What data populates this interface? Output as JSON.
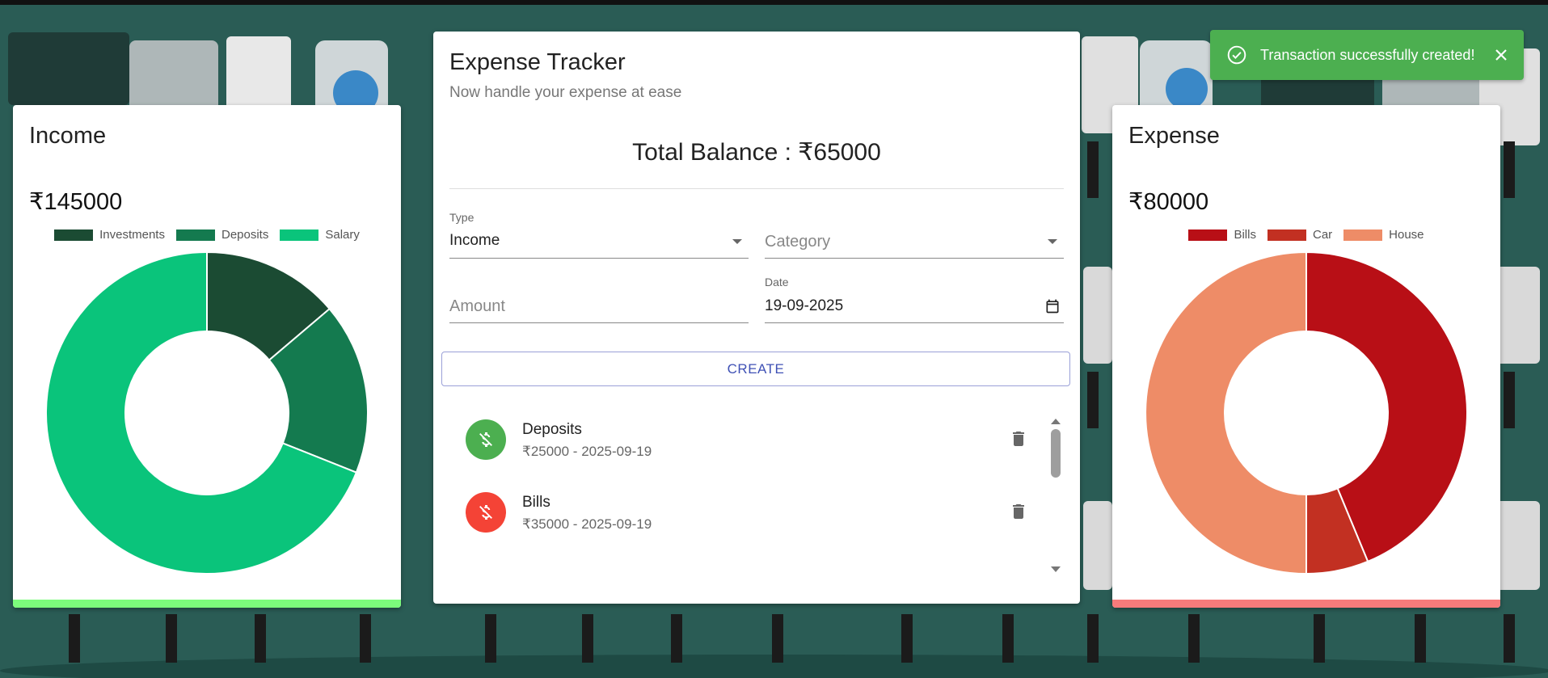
{
  "income": {
    "title": "Income",
    "amount": "₹145000",
    "bar_color": "#7cfc7c",
    "legend": [
      {
        "label": "Investments",
        "color": "#1b4b33"
      },
      {
        "label": "Deposits",
        "color": "#147a4f"
      },
      {
        "label": "Salary",
        "color": "#0ac47b"
      }
    ]
  },
  "expense": {
    "title": "Expense",
    "amount": "₹80000",
    "bar_color": "#f77b7b",
    "legend": [
      {
        "label": "Bills",
        "color": "#b80f16"
      },
      {
        "label": "Car",
        "color": "#c23022"
      },
      {
        "label": "House",
        "color": "#ee8c67"
      }
    ]
  },
  "tracker": {
    "title": "Expense Tracker",
    "subtitle": "Now handle your expense at ease",
    "balance": "Total Balance : ₹65000",
    "type_label": "Type",
    "type_value": "Income",
    "category_placeholder": "Category",
    "amount_placeholder": "Amount",
    "date_label": "Date",
    "date_value": "19-09-2025",
    "create_label": "CREATE",
    "transactions": [
      {
        "title": "Deposits",
        "sub": "₹25000 - 2025-09-19",
        "kind": "income",
        "color": "#4caf50",
        "icon": "money-off-icon"
      },
      {
        "title": "Bills",
        "sub": "₹35000 - 2025-09-19",
        "kind": "expense",
        "color": "#f44336",
        "icon": "money-off-icon"
      }
    ]
  },
  "toast": {
    "message": "Transaction successfully created!",
    "icon": "check-circle-icon",
    "close_icon": "close-icon",
    "color": "#4caf50"
  },
  "chart_data": [
    {
      "type": "pie",
      "title": "Income",
      "categories": [
        "Investments",
        "Deposits",
        "Salary"
      ],
      "values": [
        20000,
        25000,
        100000
      ],
      "colors": [
        "#1b4b33",
        "#147a4f",
        "#0ac47b"
      ],
      "legend": "top"
    },
    {
      "type": "pie",
      "title": "Expense",
      "categories": [
        "Bills",
        "Car",
        "House"
      ],
      "values": [
        35000,
        5000,
        40000
      ],
      "colors": [
        "#b80f16",
        "#c23022",
        "#ee8c67"
      ],
      "legend": "top"
    }
  ]
}
